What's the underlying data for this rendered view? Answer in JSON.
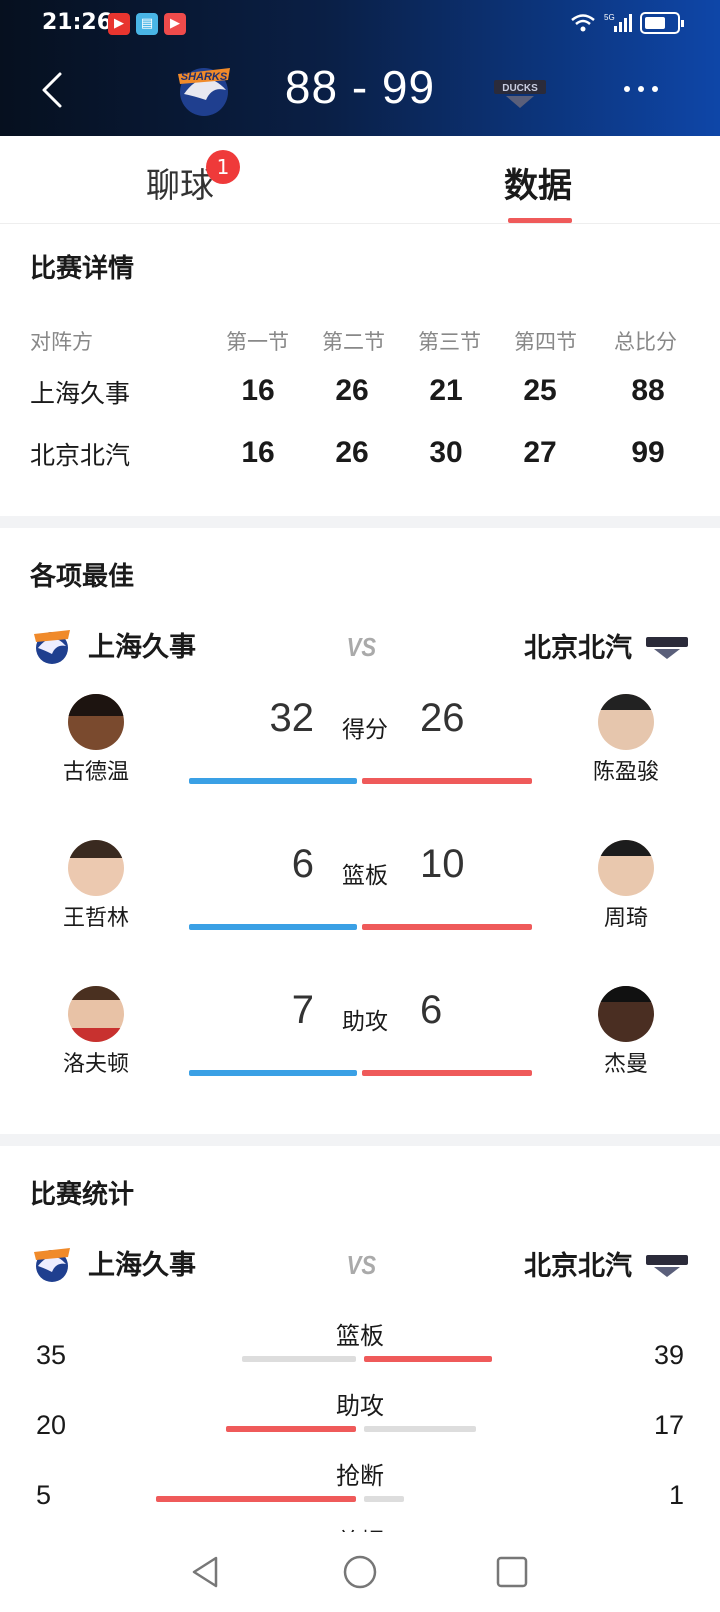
{
  "status_bar": {
    "time": "21:26",
    "network": "5G"
  },
  "header": {
    "score": "88 - 99",
    "home_logo_text": "SHARKS",
    "away_logo_text": "DUCKS"
  },
  "tabs": {
    "chat": "聊球",
    "chat_badge": "1",
    "data": "数据"
  },
  "match_details": {
    "title": "比赛详情",
    "headers": [
      "对阵方",
      "第一节",
      "第二节",
      "第三节",
      "第四节",
      "总比分"
    ],
    "rows": [
      {
        "team": "上海久事",
        "q": [
          "16",
          "26",
          "21",
          "25",
          "88"
        ]
      },
      {
        "team": "北京北汽",
        "q": [
          "16",
          "26",
          "30",
          "27",
          "99"
        ]
      }
    ]
  },
  "leaders": {
    "title": "各项最佳",
    "home_team": "上海久事",
    "away_team": "北京北汽",
    "vs": "VS",
    "items": [
      {
        "label": "得分",
        "home_player": "古德温",
        "home_value": "32",
        "away_player": "陈盈骏",
        "away_value": "26"
      },
      {
        "label": "篮板",
        "home_player": "王哲林",
        "home_value": "6",
        "away_player": "周琦",
        "away_value": "10"
      },
      {
        "label": "助攻",
        "home_player": "洛夫顿",
        "home_value": "7",
        "away_player": "杰曼",
        "away_value": "6"
      }
    ]
  },
  "stats": {
    "title": "比赛统计",
    "home_team": "上海久事",
    "away_team": "北京北汽",
    "vs": "VS",
    "items": [
      {
        "label": "篮板",
        "home": "35",
        "away": "39"
      },
      {
        "label": "助攻",
        "home": "20",
        "away": "17"
      },
      {
        "label": "抢断",
        "home": "5",
        "away": "1"
      },
      {
        "label": "盖帽",
        "home": "",
        "away": ""
      }
    ]
  },
  "colors": {
    "home_bar": "#3aa0e5",
    "away_bar": "#ef5a5a",
    "leader_bar": "#ef5a5a",
    "neutral_bar": "#dddddd"
  }
}
